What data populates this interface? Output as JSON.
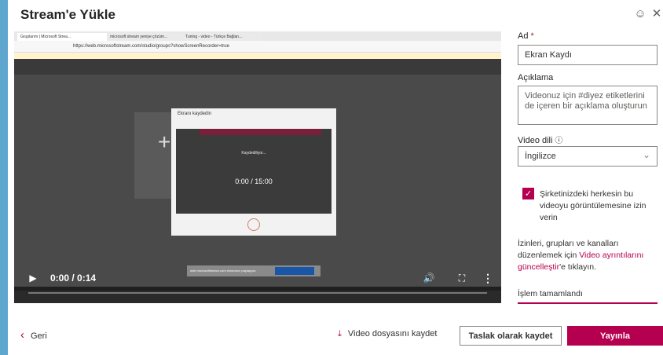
{
  "dialog": {
    "title": "Stream'e Yükle",
    "smiley_icon": "smiley-icon",
    "close_icon": "close-icon"
  },
  "video": {
    "browser_tabs": [
      "Gruplarım | Microsoft Strea...",
      "microsoft stream yeniye çözüm...",
      "Tuning - video - Türkçe Bağlan..."
    ],
    "url": "https://web.microsoftstream.com/studio/groups?showScreenRecorder=true",
    "modal_title": "Ekranı kaydedin",
    "recording_text": "Kaydediliyor...",
    "timer": "0:00 / 15:00",
    "strip_text": "web.microsoftstream.com ekranınızı paylaşıyor.",
    "time_display": "0:00 / 0:14",
    "icons": {
      "play": "play-icon",
      "volume": "volume-icon",
      "fullscreen": "fullscreen-icon",
      "more": "more-options-icon"
    }
  },
  "form": {
    "name_label": "Ad",
    "required_mark": "*",
    "name_value": "Ekran Kaydı",
    "desc_label": "Açıklama",
    "desc_placeholder": "Videonuz için #diyez etiketlerini de içeren bir açıklama oluşturun",
    "lang_label": "Video dili",
    "lang_info_icon": "info-icon",
    "lang_value": "İngilizce",
    "checkbox_text": "Şirketinizdeki herkesin bu videoyu görüntülemesine izin verin",
    "checkbox_checked": true,
    "perm_text_1": "İzinleri, grupları ve kanalları düzenlemek için",
    "perm_link": "Video ayrıntılarını güncelleştir",
    "perm_text_2": "'e tıklayın.",
    "status": "İşlem tamamlandı"
  },
  "footer": {
    "back": "Geri",
    "download": "Video dosyasını kaydet",
    "draft": "Taslak olarak kaydet",
    "publish": "Yayınla"
  },
  "colors": {
    "accent": "#b4004e"
  }
}
